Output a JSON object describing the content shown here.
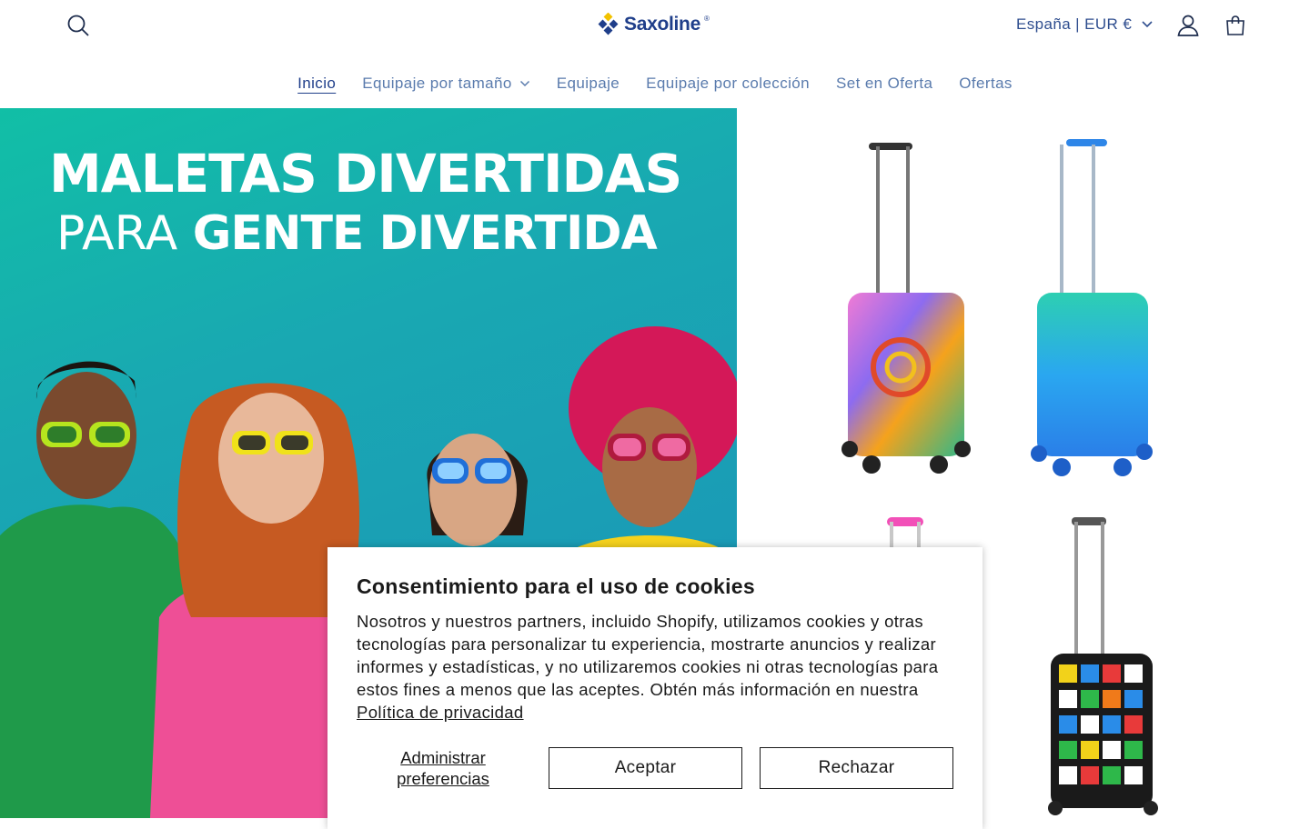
{
  "brand": {
    "name": "Saxoline",
    "reg": "®"
  },
  "header": {
    "locale_label": "España | EUR €"
  },
  "nav": {
    "items": [
      {
        "label": "Inicio",
        "active": true
      },
      {
        "label": "Equipaje por tamaño",
        "has_dropdown": true
      },
      {
        "label": "Equipaje"
      },
      {
        "label": "Equipaje por colección"
      },
      {
        "label": "Set en Oferta"
      },
      {
        "label": "Ofertas"
      }
    ]
  },
  "hero": {
    "title_line1": "MALETAS DIVERTIDAS",
    "title_line2_light": "PARA",
    "title_line2_bold": "GENTE DIVERTIDA"
  },
  "cookie": {
    "title": "Consentimiento para el uso de cookies",
    "body": "Nosotros y nuestros partners, incluido Shopify, utilizamos cookies y otras tecnologías para personalizar tu experiencia, mostrarte anuncios y realizar informes y estadísticas, y no utilizaremos cookies ni otras tecnologías para estos fines a menos que las aceptes. Obtén más información en nuestra",
    "privacy_link": "Política de privacidad",
    "manage_label": "Administrar preferencias",
    "accept_label": "Aceptar",
    "reject_label": "Rechazar"
  },
  "colors": {
    "brand_blue": "#1f3e8a",
    "nav_text": "#5a7bad",
    "hero_gradient_start": "#11bfa6",
    "hero_gradient_end": "#1b91b9"
  },
  "icons": [
    "search-icon",
    "logo-diamond-icon",
    "chevron-down-icon",
    "account-icon",
    "cart-icon"
  ]
}
